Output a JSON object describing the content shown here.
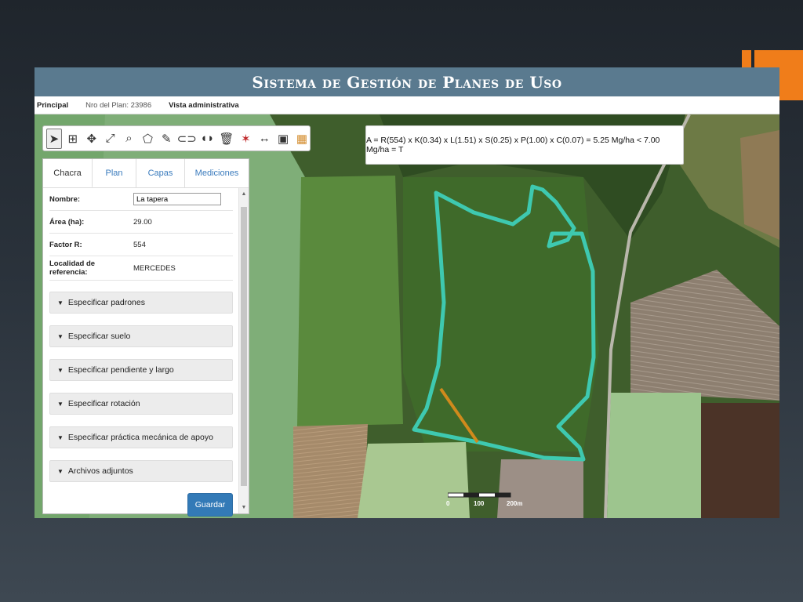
{
  "app": {
    "title": "Sistema de Gestión de Planes de Uso"
  },
  "menubar": {
    "principal": "Principal",
    "plan_number": "Nro del Plan: 23986",
    "admin_view": "Vista administrativa"
  },
  "toolbar": {
    "tools": [
      "pointer-icon",
      "zoom-icon",
      "collapse-icon",
      "expand-icon",
      "location-search-icon",
      "polygon-icon",
      "edit-icon",
      "merge-icon",
      "split-icon",
      "delete-icon",
      "measure-icon",
      "ruler-icon",
      "image-icon",
      "layers-grid-icon"
    ]
  },
  "formula": {
    "text": "A = R(554) x K(0.34) x L(1.51) x S(0.25) x P(1.00) x C(0.07) = 5.25 Mg/ha < 7.00 Mg/ha = T"
  },
  "tabs": [
    {
      "label": "Chacra",
      "active": true
    },
    {
      "label": "Plan",
      "active": false
    },
    {
      "label": "Capas",
      "active": false
    },
    {
      "label": "Mediciones",
      "active": false
    }
  ],
  "fields": {
    "nombre_label": "Nombre:",
    "nombre_value": "La tapera",
    "area_label": "Área (ha):",
    "area_value": "29.00",
    "factor_label": "Factor R:",
    "factor_value": "554",
    "localidad_label": "Localidad de referencia:",
    "localidad_value": "MERCEDES"
  },
  "sections": [
    "Especificar padrones",
    "Especificar suelo",
    "Especificar pendiente y largo",
    "Especificar rotación",
    "Especificar práctica mecánica de apoyo",
    "Archivos adjuntos"
  ],
  "save_label": "Guardar",
  "scale": {
    "zero": "0",
    "mid": "100",
    "end": "200m"
  },
  "colors": {
    "title_bar": "#5a7a8f",
    "accent_orange": "#f07d1a",
    "field_outline": "#3ec9b0",
    "slope_line": "#d08a1c",
    "button": "#337ab7"
  }
}
